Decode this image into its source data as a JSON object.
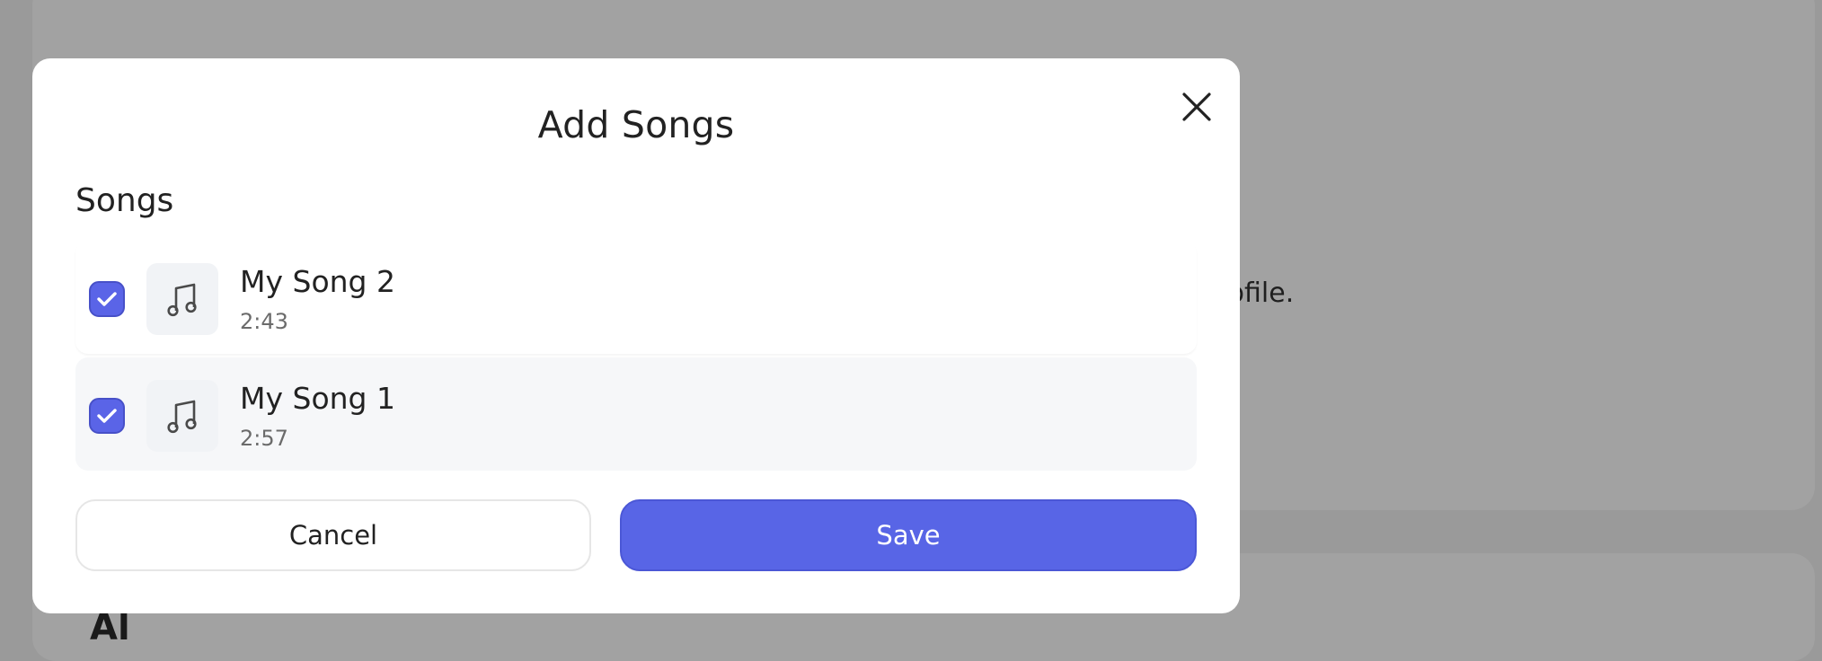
{
  "background": {
    "text_fragment": "rofile.",
    "heading_fragment": "Al"
  },
  "modal": {
    "title": "Add Songs",
    "close_icon": "close-icon",
    "section_label": "Songs",
    "songs": [
      {
        "title": "My Song 2",
        "duration": "2:43",
        "checked": true,
        "icon": "music-note-icon"
      },
      {
        "title": "My Song 1",
        "duration": "2:57",
        "checked": true,
        "icon": "music-note-icon"
      }
    ],
    "buttons": {
      "cancel_label": "Cancel",
      "save_label": "Save"
    }
  },
  "colors": {
    "accent": "#5865E6",
    "checkbox": "#5A64E7",
    "overlay": "#9A9A9A"
  }
}
